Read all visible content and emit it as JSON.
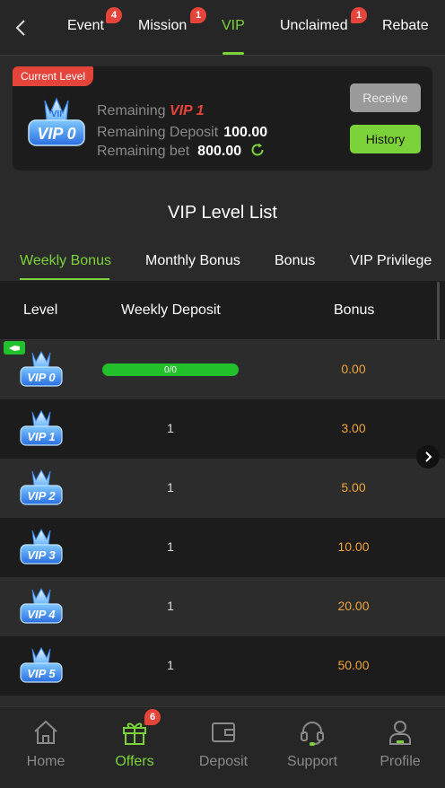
{
  "top_nav": {
    "tabs": [
      {
        "label": "Event",
        "badge": "4"
      },
      {
        "label": "Mission",
        "badge": "1"
      },
      {
        "label": "VIP",
        "badge": null
      },
      {
        "label": "Unclaimed",
        "badge": "1"
      },
      {
        "label": "Rebate",
        "badge": null
      }
    ],
    "active_tab": "VIP"
  },
  "current_level": {
    "tag": "Current Level",
    "badge_text": "VIP 0",
    "remaining_label": "Remaining",
    "remaining_value": "VIP 1",
    "deposit_label": "Remaining Deposit",
    "deposit_value": "100.00",
    "bet_label": "Remaining bet",
    "bet_value": "800.00",
    "receive_label": "Receive",
    "history_label": "History"
  },
  "list": {
    "title": "VIP Level List",
    "tabs": [
      "Weekly Bonus",
      "Monthly Bonus",
      "Bonus",
      "VIP Privilege"
    ],
    "active_tab": "Weekly Bonus",
    "headers": {
      "level": "Level",
      "deposit": "Weekly Deposit",
      "bonus": "Bonus"
    },
    "rows": [
      {
        "level": "VIP 0",
        "deposit": "0/0",
        "progress": 1.0,
        "bonus": "0.00"
      },
      {
        "level": "VIP 1",
        "deposit": "1",
        "bonus": "3.00"
      },
      {
        "level": "VIP 2",
        "deposit": "1",
        "bonus": "5.00"
      },
      {
        "level": "VIP 3",
        "deposit": "1",
        "bonus": "10.00"
      },
      {
        "level": "VIP 4",
        "deposit": "1",
        "bonus": "20.00"
      },
      {
        "level": "VIP 5",
        "deposit": "1",
        "bonus": "50.00"
      }
    ]
  },
  "bottom_nav": {
    "items": [
      {
        "label": "Home",
        "icon": "home-icon"
      },
      {
        "label": "Offers",
        "icon": "gift-icon",
        "badge": "6"
      },
      {
        "label": "Deposit",
        "icon": "wallet-icon"
      },
      {
        "label": "Support",
        "icon": "headset-icon"
      },
      {
        "label": "Profile",
        "icon": "user-icon"
      }
    ],
    "active": "Offers"
  },
  "colors": {
    "accent": "#7bd339",
    "badge": "#e5443a",
    "bonus": "#f0a43a",
    "progress": "#22c02a"
  }
}
